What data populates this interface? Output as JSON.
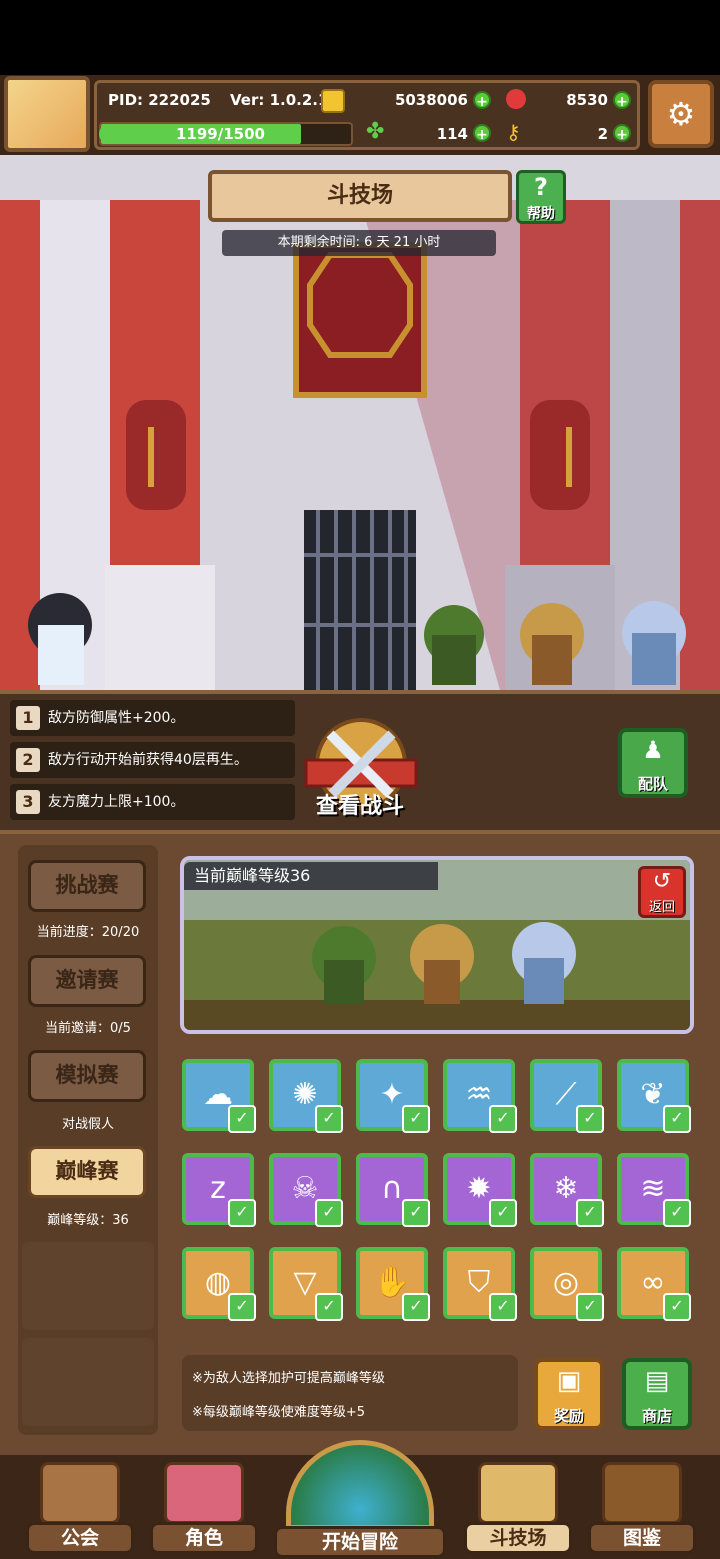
{
  "header": {
    "pid": "PID: 222025",
    "version": "Ver: 1.0.2.1",
    "gold": "5038006",
    "gems": "8530",
    "energy": "1199/1500",
    "clover": "114",
    "keys": "2"
  },
  "arena": {
    "title": "斗技场",
    "help_label": "帮助",
    "timer": "本期剩余时间: 6 天 21 小时"
  },
  "modifiers": [
    {
      "num": "1",
      "text": "敌方防御属性+200。"
    },
    {
      "num": "2",
      "text": "敌方行动开始前获得40层再生。"
    },
    {
      "num": "3",
      "text": "友方魔力上限+100。"
    }
  ],
  "battle": {
    "view_label": "查看战斗",
    "team_label": "配队"
  },
  "modes": [
    {
      "label": "挑战赛",
      "sub": "当前进度：20/20",
      "active": false
    },
    {
      "label": "邀请赛",
      "sub": "当前邀请：0/5",
      "active": false
    },
    {
      "label": "模拟赛",
      "sub": "对战假人",
      "active": false
    },
    {
      "label": "巅峰赛",
      "sub": "巅峰等级：36",
      "active": true
    }
  ],
  "preview": {
    "peak_level": "当前巅峰等级36",
    "return_label": "返回"
  },
  "buff_tiles": [
    {
      "icon": "cloud-icon",
      "color": "#5ea9d6"
    },
    {
      "icon": "gear-ring-icon",
      "color": "#5ea9d6"
    },
    {
      "icon": "sparkle-icon",
      "color": "#5ea9d6"
    },
    {
      "icon": "tornado-icon",
      "color": "#5ea9d6"
    },
    {
      "icon": "blade-icon",
      "color": "#5ea9d6"
    },
    {
      "icon": "paw-icon",
      "color": "#5ea9d6"
    },
    {
      "icon": "sleep-icon",
      "color": "#a466d4"
    },
    {
      "icon": "skull-icon",
      "color": "#a466d4"
    },
    {
      "icon": "tombstone-icon",
      "color": "#a466d4"
    },
    {
      "icon": "explosion-icon",
      "color": "#a466d4"
    },
    {
      "icon": "snowflake-icon",
      "color": "#a466d4"
    },
    {
      "icon": "wind-icon",
      "color": "#a466d4"
    },
    {
      "icon": "shell-icon",
      "color": "#e0a24c"
    },
    {
      "icon": "triangle-shield-icon",
      "color": "#e0a24c"
    },
    {
      "icon": "claw-icon",
      "color": "#e0a24c"
    },
    {
      "icon": "shield-icon",
      "color": "#e0a24c"
    },
    {
      "icon": "rings-icon",
      "color": "#e0a24c"
    },
    {
      "icon": "infinity-icon",
      "color": "#e0a24c"
    }
  ],
  "notes": [
    "※为敌人选择加护可提高巅峰等级",
    "※每级巅峰等级使难度等级+5"
  ],
  "actions": {
    "reward_label": "奖励",
    "shop_label": "商店"
  },
  "nav": [
    {
      "label": "公会",
      "active": false
    },
    {
      "label": "角色",
      "active": false
    },
    {
      "label": "开始冒险",
      "active": false
    },
    {
      "label": "斗技场",
      "active": true
    },
    {
      "label": "图鉴",
      "active": false
    }
  ]
}
